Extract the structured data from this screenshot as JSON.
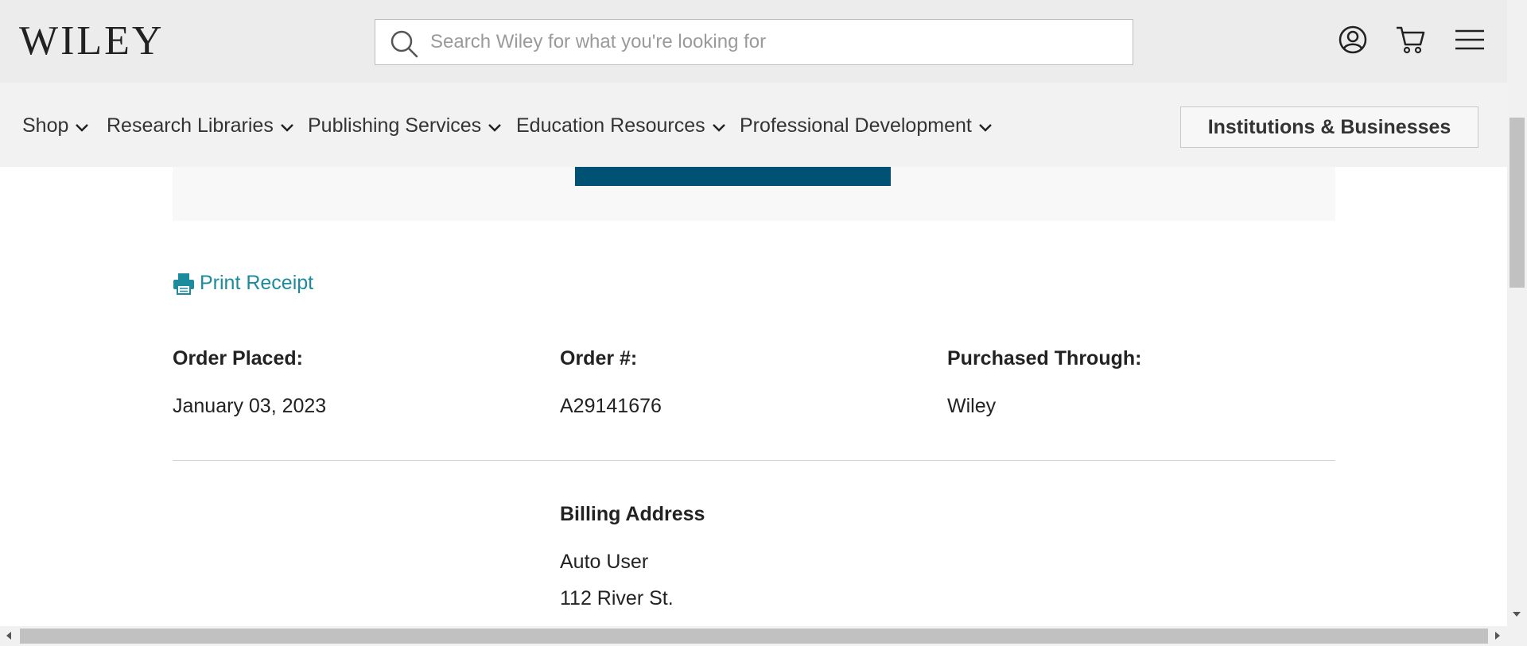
{
  "header": {
    "logo_text": "WILEY",
    "search_placeholder": "Search Wiley for what you're looking for",
    "search_value": "",
    "icons": [
      "user-account-icon",
      "shopping-cart-icon",
      "hamburger-menu-icon"
    ]
  },
  "nav": {
    "items": [
      {
        "label": "Shop"
      },
      {
        "label": "Research Libraries"
      },
      {
        "label": "Publishing Services"
      },
      {
        "label": "Education Resources"
      },
      {
        "label": "Professional Development"
      }
    ],
    "institutions_button": "Institutions & Businesses"
  },
  "order": {
    "print_receipt": "Print Receipt",
    "placed_label": "Order Placed:",
    "placed_value": "January 03, 2023",
    "number_label": "Order #:",
    "number_value": "A29141676",
    "purchased_label": "Purchased Through:",
    "purchased_value": "Wiley"
  },
  "billing": {
    "title": "Billing Address",
    "name": "Auto User",
    "street": "112 River St."
  },
  "colors": {
    "header_bg": "#ececec",
    "nav_bg": "#f2f2f2",
    "link_teal": "#1c8b9c",
    "button_dark_blue": "#005274"
  }
}
